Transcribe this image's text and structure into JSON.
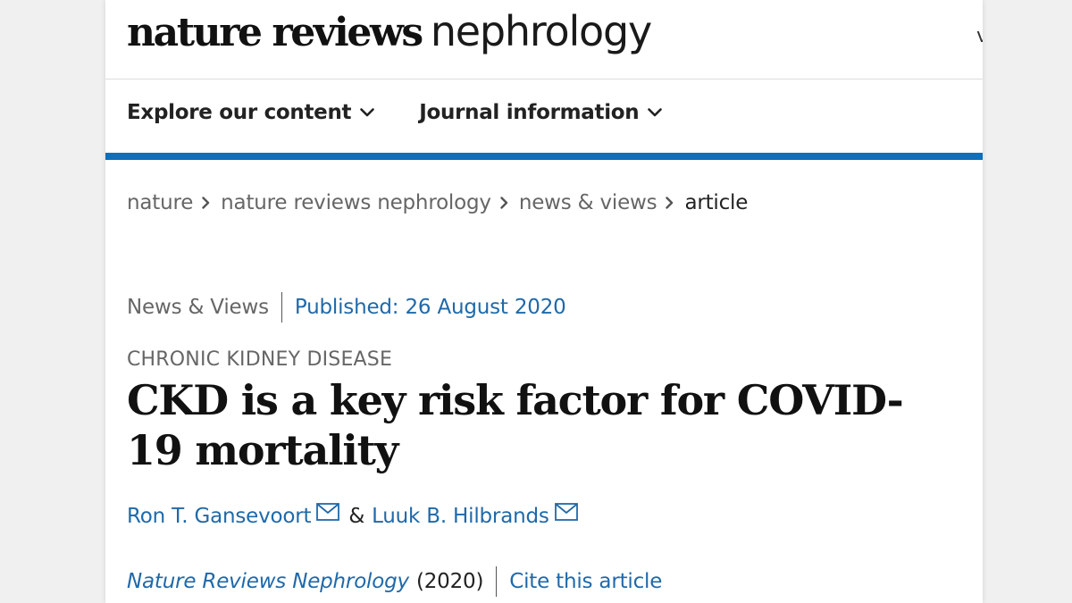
{
  "header": {
    "brand_bold": "nature reviews",
    "brand_light": "nephrology",
    "edge_text": "v"
  },
  "nav": {
    "items": [
      {
        "label": "Explore our content"
      },
      {
        "label": "Journal information"
      }
    ]
  },
  "breadcrumb": {
    "items": [
      {
        "label": "nature"
      },
      {
        "label": "nature reviews nephrology"
      },
      {
        "label": "news & views"
      },
      {
        "label": "article"
      }
    ]
  },
  "article": {
    "type": "News & Views",
    "published": "Published: 26 August 2020",
    "subject": "CHRONIC KIDNEY DISEASE",
    "title": "CKD is a key risk factor for COVID-19 mortality",
    "authors": [
      {
        "name": "Ron T. Gansevoort"
      },
      {
        "name": "Luuk B. Hilbrands"
      }
    ],
    "author_separator": "&",
    "journal": "Nature Reviews Nephrology",
    "year": "(2020)",
    "cite_label": "Cite this article"
  },
  "icons": {
    "chevron": "chevron-down-icon",
    "breadcrumb_separator": "chevron-right-icon",
    "email": "mail-icon"
  },
  "colors": {
    "accent": "#0e6fba",
    "link": "#1f69a9",
    "text": "#222222",
    "muted": "#666666"
  }
}
